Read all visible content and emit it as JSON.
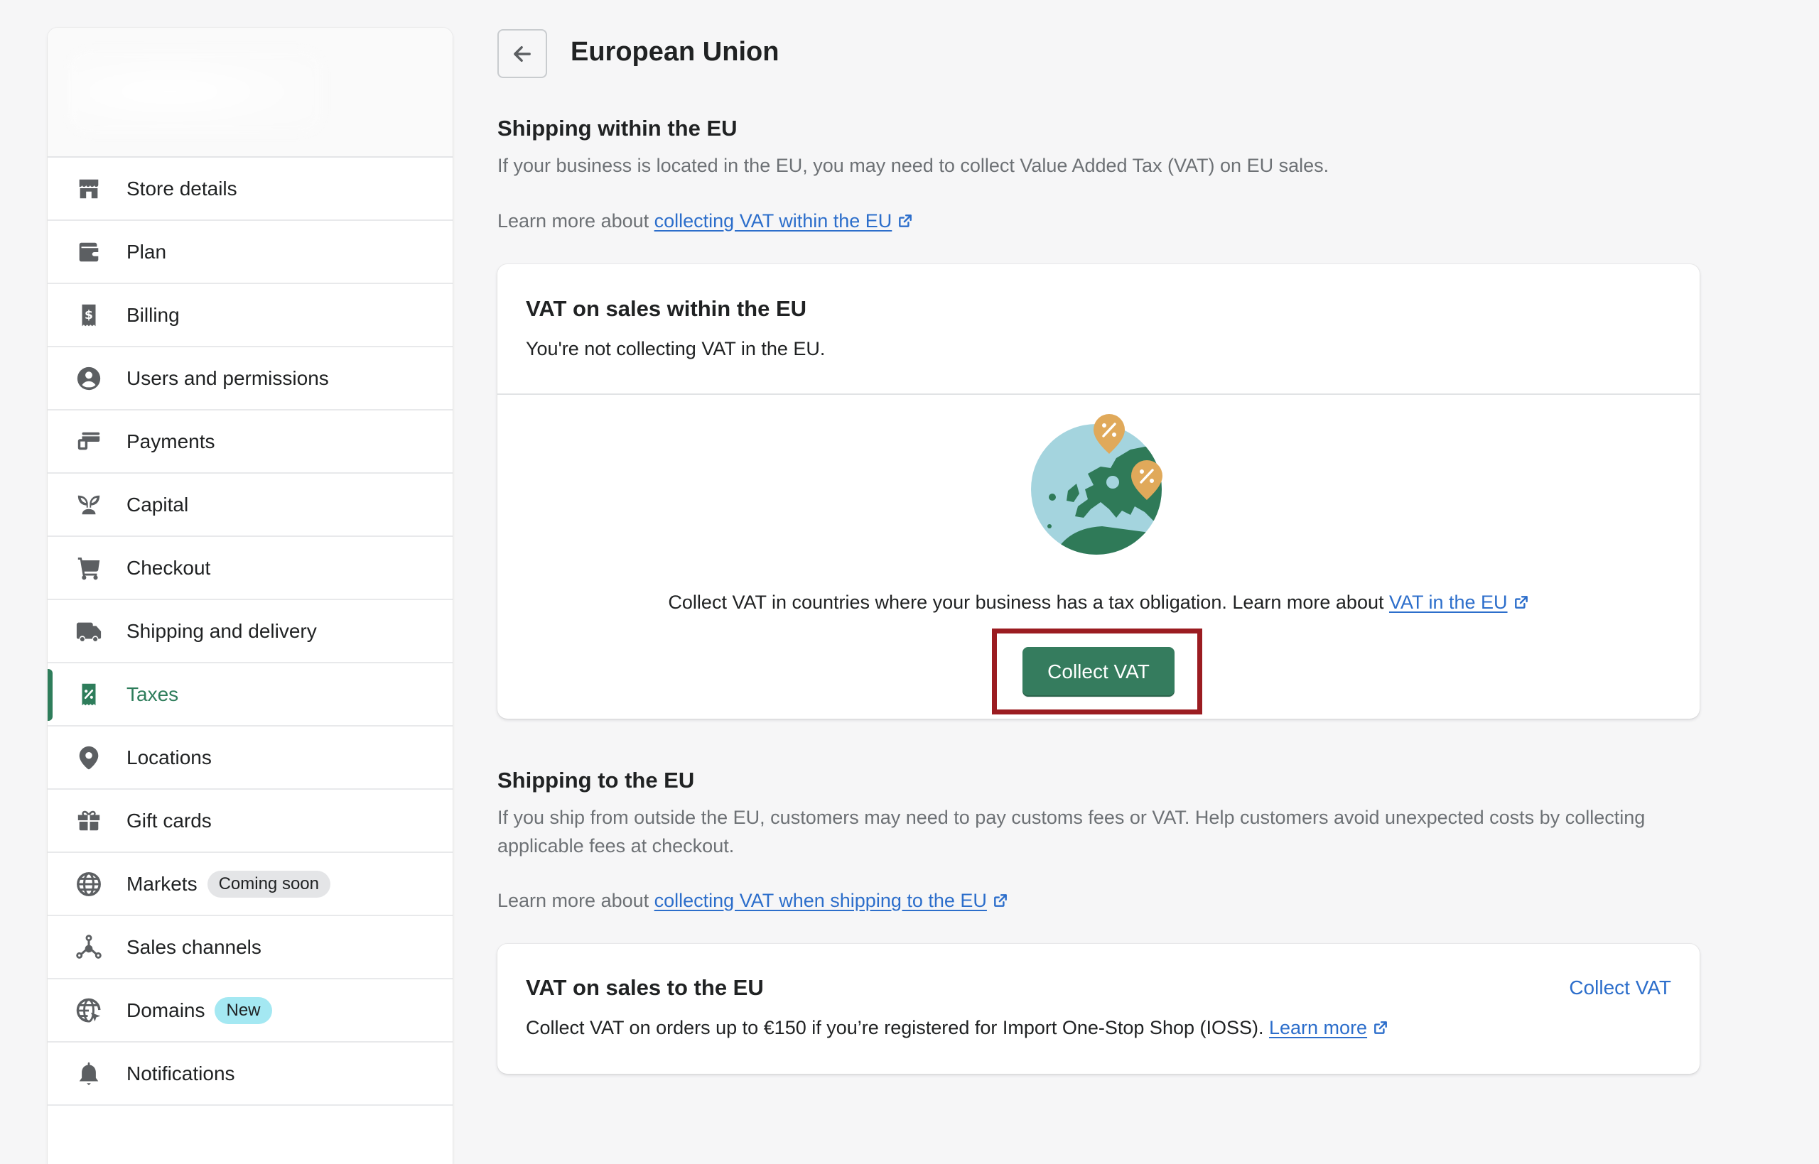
{
  "sidebar": {
    "store_name_hidden": true,
    "items": [
      {
        "label": "Store details",
        "icon": "store-icon"
      },
      {
        "label": "Plan",
        "icon": "wallet-icon"
      },
      {
        "label": "Billing",
        "icon": "receipt-dollar-icon"
      },
      {
        "label": "Users and permissions",
        "icon": "user-circle-icon"
      },
      {
        "label": "Payments",
        "icon": "payments-icon"
      },
      {
        "label": "Capital",
        "icon": "plant-icon"
      },
      {
        "label": "Checkout",
        "icon": "cart-icon"
      },
      {
        "label": "Shipping and delivery",
        "icon": "truck-icon"
      },
      {
        "label": "Taxes",
        "icon": "receipt-percent-icon",
        "active": true
      },
      {
        "label": "Locations",
        "icon": "location-pin-icon"
      },
      {
        "label": "Gift cards",
        "icon": "gift-icon"
      },
      {
        "label": "Markets",
        "icon": "globe-icon",
        "badge": "Coming soon"
      },
      {
        "label": "Sales channels",
        "icon": "channels-icon"
      },
      {
        "label": "Domains",
        "icon": "domain-globe-icon",
        "badge": "New"
      },
      {
        "label": "Notifications",
        "icon": "bell-icon"
      }
    ]
  },
  "header": {
    "back_icon": "arrow-left-icon",
    "title": "European Union"
  },
  "within_eu": {
    "title": "Shipping within the EU",
    "description": "If your business is located in the EU, you may need to collect Value Added Tax (VAT) on EU sales.",
    "learn_prefix": "Learn more about ",
    "learn_link": "collecting VAT within the EU",
    "card": {
      "title": "VAT on sales within the EU",
      "status": "You're not collecting VAT in the EU.",
      "illustration": "europe-map-tax-illustration",
      "body_text": "Collect VAT in countries where your business has a tax obligation. Learn more about ",
      "body_link": "VAT in the EU",
      "button_label": "Collect VAT"
    }
  },
  "to_eu": {
    "title": "Shipping to the EU",
    "description": "If you ship from outside the EU, customers may need to pay customs fees or VAT. Help customers avoid unexpected costs by collecting applicable fees at checkout.",
    "learn_prefix": "Learn more about ",
    "learn_link": "collecting VAT when shipping to the EU",
    "card": {
      "title": "VAT on sales to the EU",
      "action_label": "Collect VAT",
      "body_text": "Collect VAT on orders up to €150 if you’re registered for Import One-Stop Shop (IOSS). ",
      "body_link": "Learn more"
    }
  },
  "colors": {
    "accent_green": "#357c5e",
    "active_nav": "#2e7d5b",
    "link_blue": "#2c6ecb",
    "highlight_red": "#9b1c21"
  }
}
